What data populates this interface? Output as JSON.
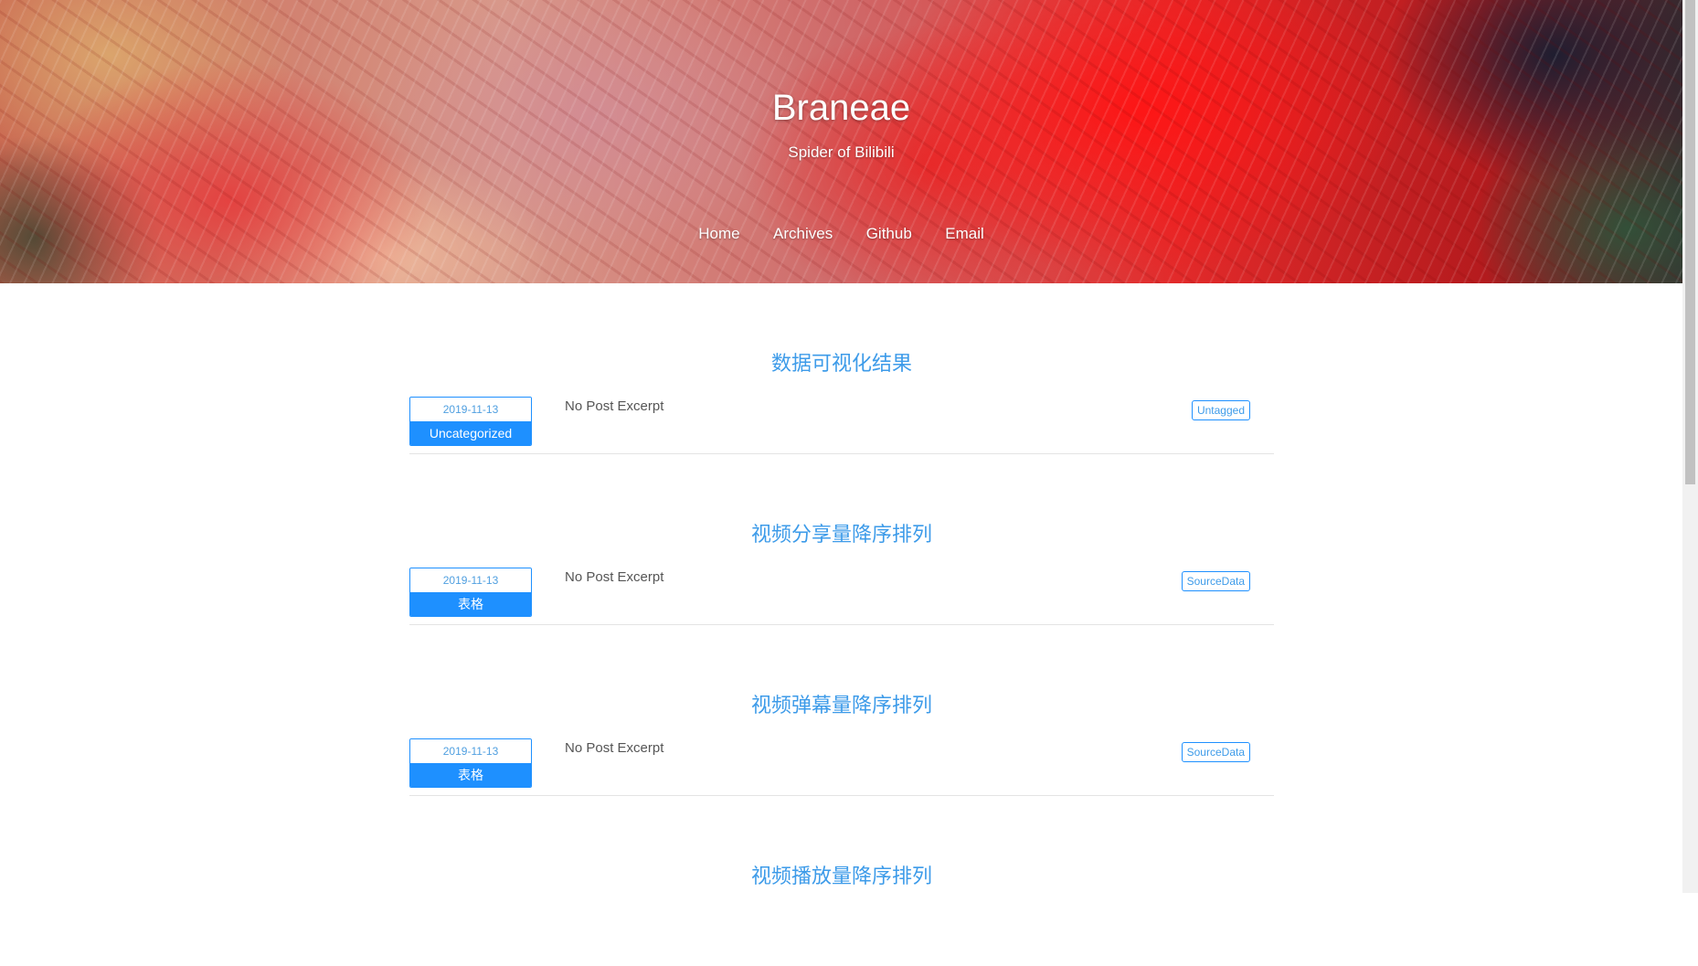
{
  "site": {
    "title": "Braneae",
    "subtitle": "Spider of Bilibili"
  },
  "nav": [
    {
      "label": "Home"
    },
    {
      "label": "Archives"
    },
    {
      "label": "Github"
    },
    {
      "label": "Email"
    }
  ],
  "posts": [
    {
      "title": "数据可视化结果",
      "date": "2019-11-13",
      "category": "Uncategorized",
      "excerpt": "No Post Excerpt",
      "tag": "Untagged"
    },
    {
      "title": "视频分享量降序排列",
      "date": "2019-11-13",
      "category": "表格",
      "excerpt": "No Post Excerpt",
      "tag": "SourceData"
    },
    {
      "title": "视频弹幕量降序排列",
      "date": "2019-11-13",
      "category": "表格",
      "excerpt": "No Post Excerpt",
      "tag": "SourceData"
    },
    {
      "title": "视频播放量降序排列"
    }
  ],
  "colors": {
    "accent": "#1e90ff",
    "title_link": "#3d9be9",
    "excerpt_text": "#555555",
    "divider": "#e4e4e4"
  }
}
